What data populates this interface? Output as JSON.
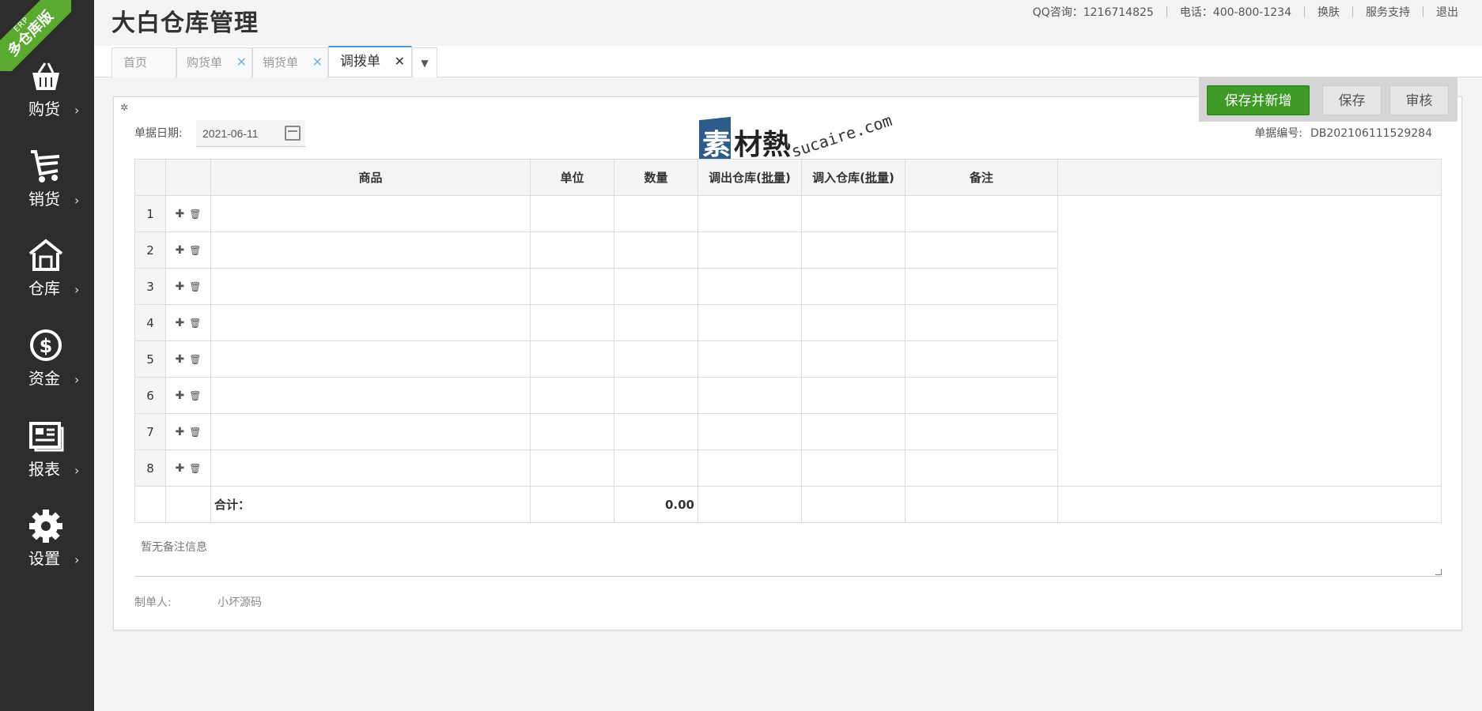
{
  "sidebar": {
    "ribbon_small": "ERP",
    "ribbon_big": "多仓库版",
    "items": [
      {
        "label": "购货",
        "icon": "basket-icon"
      },
      {
        "label": "销货",
        "icon": "cart-icon"
      },
      {
        "label": "仓库",
        "icon": "warehouse-icon"
      },
      {
        "label": "资金",
        "icon": "dollar-icon"
      },
      {
        "label": "报表",
        "icon": "report-icon"
      },
      {
        "label": "设置",
        "icon": "gear-icon"
      }
    ]
  },
  "header": {
    "title": "大白仓库管理",
    "links": [
      "QQ咨询：1216714825",
      "电话：400-800-1234",
      "换肤",
      "服务支持",
      "退出"
    ]
  },
  "tabs": [
    {
      "label": "首页",
      "closable": false,
      "active": false
    },
    {
      "label": "购货单",
      "closable": true,
      "active": false
    },
    {
      "label": "销货单",
      "closable": true,
      "active": false
    },
    {
      "label": "调拨单",
      "closable": true,
      "active": true
    }
  ],
  "actions": {
    "save_new": "保存并新增",
    "save": "保存",
    "audit": "审核"
  },
  "form": {
    "date_label": "单据日期:",
    "date_value": "2021-06-11",
    "doc_no_label": "单据编号:",
    "doc_no_value": "DB202106111529284"
  },
  "watermark": {
    "char1": "素",
    "chars": "材熱",
    "en": "sucaire.com"
  },
  "table": {
    "headers": {
      "product": "商品",
      "unit": "单位",
      "qty": "数量",
      "out_wh": "调出仓库",
      "in_wh": "调入仓库",
      "batch": "批量",
      "note": "备注"
    },
    "rows": [
      "1",
      "2",
      "3",
      "4",
      "5",
      "6",
      "7",
      "8"
    ],
    "total_label": "合计：",
    "total_qty": "0.00"
  },
  "remark_placeholder": "暂无备注信息",
  "maker": {
    "label": "制单人:",
    "value": "小坏源码"
  },
  "colors": {
    "sidebar_bg": "#2d2d2d",
    "ribbon": "#5aaa2f",
    "primary_button": "#3d9a26",
    "tab_active_border": "#4a9bd6"
  }
}
